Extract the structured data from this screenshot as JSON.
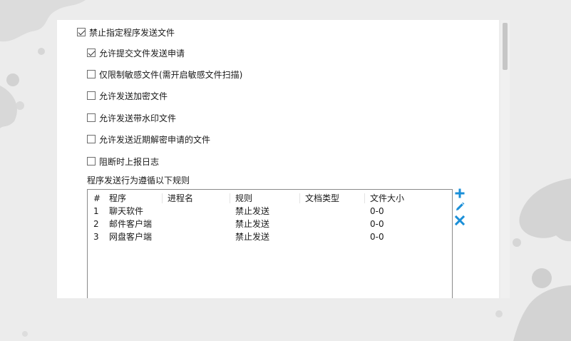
{
  "options": {
    "block_send": {
      "label": "禁止指定程序发送文件",
      "checked": true
    },
    "allow_apply": {
      "label": "允许提交文件发送申请",
      "checked": true
    },
    "sensitive_only": {
      "label": "仅限制敏感文件(需开启敏感文件扫描)",
      "checked": false
    },
    "allow_encrypted": {
      "label": "允许发送加密文件",
      "checked": false
    },
    "allow_watermark": {
      "label": "允许发送带水印文件",
      "checked": false
    },
    "allow_recent_decrypt": {
      "label": "允许发送近期解密申请的文件",
      "checked": false
    },
    "report_log": {
      "label": "阻断时上报日志",
      "checked": false
    }
  },
  "rules_section": {
    "title": "程序发送行为遵循以下规则"
  },
  "rules_table": {
    "headers": {
      "num": "#",
      "program": "程序",
      "process": "进程名",
      "rule": "规则",
      "doc_type": "文档类型",
      "file_size": "文件大小"
    },
    "rows": [
      {
        "num": "1",
        "program": "聊天软件",
        "process": "",
        "rule": "禁止发送",
        "doc_type": "",
        "file_size": "0-0"
      },
      {
        "num": "2",
        "program": "邮件客户端",
        "process": "",
        "rule": "禁止发送",
        "doc_type": "",
        "file_size": "0-0"
      },
      {
        "num": "3",
        "program": "网盘客户端",
        "process": "",
        "rule": "禁止发送",
        "doc_type": "",
        "file_size": "0-0"
      }
    ]
  },
  "toolbar": {
    "add_icon": "plus-icon",
    "edit_icon": "pencil-icon",
    "delete_icon": "close-icon"
  },
  "colors": {
    "accent": "#1a8fd8"
  }
}
